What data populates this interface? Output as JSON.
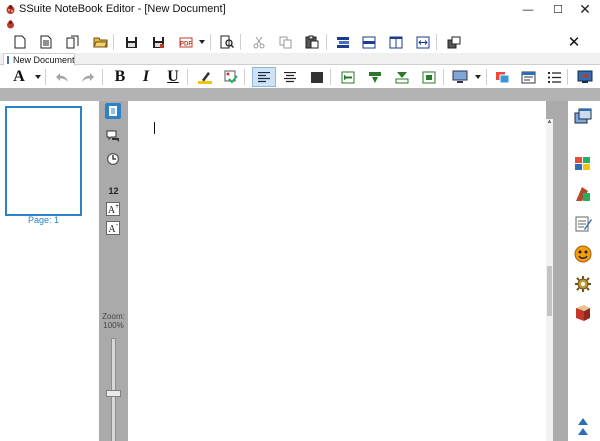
{
  "window": {
    "title": "SSuite NoteBook Editor - [New Document]",
    "min_glyph": "—",
    "max_glyph": "☐",
    "close_glyph": "✕"
  },
  "toolbar1": {
    "close_glyph": "✕",
    "icons": [
      "new-document-icon",
      "open-document-icon",
      "copy-document-icon",
      "open-folder-icon",
      "save-icon",
      "save-as-icon",
      "export-pdf-icon",
      "dropdown-arrow-icon",
      "print-preview-icon",
      "cut-icon",
      "copy-icon",
      "paste-icon",
      "indent-icon",
      "outdent-icon",
      "columns-icon",
      "page-break-icon",
      "insert-icon"
    ]
  },
  "tab": {
    "label": "New Document"
  },
  "toolbar2": {
    "font_glyph": "A",
    "bold": "B",
    "italic": "I",
    "underline": "U",
    "icons": [
      "font-icon",
      "undo-icon",
      "redo-icon",
      "bold-icon",
      "italic-icon",
      "underline-icon",
      "highlighter-icon",
      "spellcheck-icon",
      "align-left-icon",
      "align-center-icon",
      "align-justify-icon",
      "indent-left-icon",
      "indent-right-icon",
      "line-spacing-icon",
      "paragraph-icon",
      "screen-icon",
      "color-icon",
      "table-icon",
      "list-icon",
      "monitor-icon"
    ]
  },
  "sidebar": {
    "page_label": "Page: 1",
    "font_size": "12",
    "zoom_label": "Zoom:",
    "zoom_value": "100%",
    "zoom_level_percent": 100
  },
  "right_tools": [
    "window-icon",
    "windows-logo-icon",
    "stamp-icon",
    "notepad-icon",
    "smiley-icon",
    "gear-icon",
    "book-icon"
  ],
  "colors": {
    "accent": "#2b82c9",
    "workspace": "#ababab",
    "toolbar": "#ffffff"
  }
}
